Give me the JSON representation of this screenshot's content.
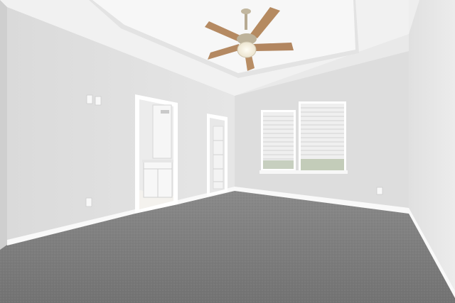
{
  "scene": {
    "subject": "empty-bedroom",
    "colors": {
      "ceiling": "#f4f4f4",
      "tray_ceiling": "#f7f7f7",
      "left_wall": "#e2e2e2",
      "back_wall": "#dcdcdc",
      "right_wall": "#e6e6e6",
      "carpet": "#7e7e7e",
      "baseboard": "#f8f8f8",
      "fan_blade": "#b48a62",
      "fan_metal": "#b9ad95",
      "fan_light": "#fbf6e8",
      "blinds": "#f2f2f2",
      "window_frame": "#ffffff",
      "bathroom": "#eeeeee",
      "cabinet": "#f6f6f6"
    }
  }
}
